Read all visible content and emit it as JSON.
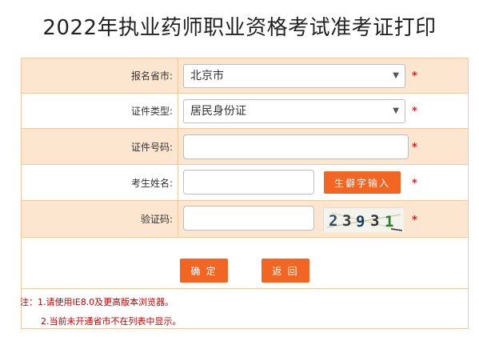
{
  "page": {
    "title": "2022年执业药师职业资格考试准考证打印"
  },
  "form": {
    "province": {
      "label": "报名省市:",
      "selected": "北京市"
    },
    "id_type": {
      "label": "证件类型:",
      "selected": "居民身份证"
    },
    "id_number": {
      "label": "证件号码:",
      "value": ""
    },
    "name": {
      "label": "考生姓名:",
      "value": "",
      "rare_char_button": "生僻字输入"
    },
    "captcha": {
      "label": "验证码:",
      "value": "",
      "image_text": "23931"
    },
    "required_mark": "*"
  },
  "actions": {
    "confirm": "确 定",
    "back": "返 回"
  },
  "notes": {
    "line1": "注：1.请使用IE8.0及更高版本浏览器。",
    "line2": "2.当前未开通省市不在列表中显示。"
  },
  "colors": {
    "accent": "#f26522",
    "row_shade": "#fde6cf",
    "border": "#f0c9a0",
    "required": "#e02020",
    "note": "#c00000"
  }
}
